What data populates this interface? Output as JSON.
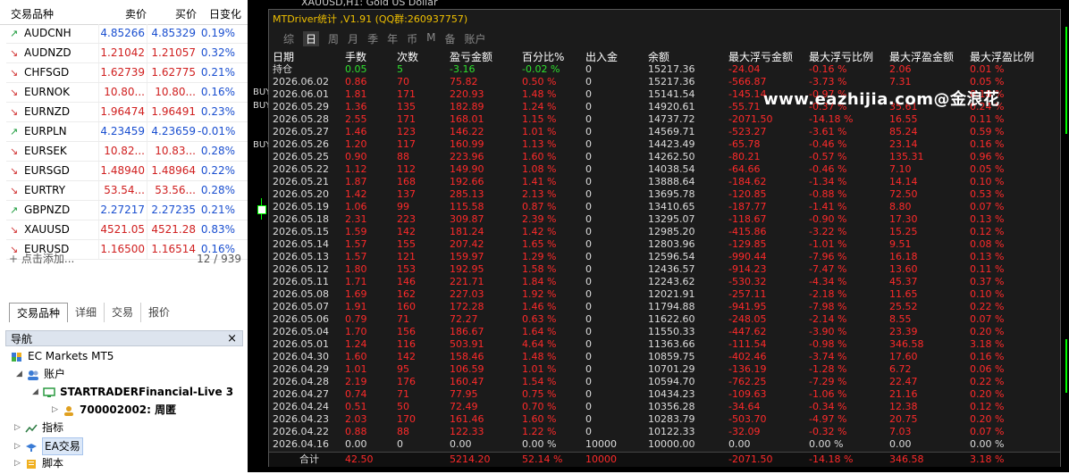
{
  "market_watch": {
    "headers": {
      "symbol": "交易品种",
      "bid": "卖价",
      "ask": "买价",
      "change": "日变化"
    },
    "rows": [
      {
        "symbol": "AUDCNH",
        "dir": "up",
        "bid": "4.85266",
        "ask": "4.85329",
        "change": "0.19%"
      },
      {
        "symbol": "AUDNZD",
        "dir": "dn",
        "bid": "1.21042",
        "ask": "1.21057",
        "change": "0.32%"
      },
      {
        "symbol": "CHFSGD",
        "dir": "dn",
        "bid": "1.62739",
        "ask": "1.62775",
        "change": "0.21%"
      },
      {
        "symbol": "EURNOK",
        "dir": "dn",
        "bid": "10.80...",
        "ask": "10.80...",
        "change": "0.16%"
      },
      {
        "symbol": "EURNZD",
        "dir": "dn",
        "bid": "1.96474",
        "ask": "1.96491",
        "change": "0.23%"
      },
      {
        "symbol": "EURPLN",
        "dir": "up",
        "bid": "4.23459",
        "ask": "4.23659",
        "change": "-0.01%"
      },
      {
        "symbol": "EURSEK",
        "dir": "dn",
        "bid": "10.82...",
        "ask": "10.83...",
        "change": "0.28%"
      },
      {
        "symbol": "EURSGD",
        "dir": "dn",
        "bid": "1.48940",
        "ask": "1.48964",
        "change": "0.22%"
      },
      {
        "symbol": "EURTRY",
        "dir": "dn",
        "bid": "53.54...",
        "ask": "53.56...",
        "change": "0.28%"
      },
      {
        "symbol": "GBPNZD",
        "dir": "up",
        "bid": "2.27217",
        "ask": "2.27235",
        "change": "0.21%"
      },
      {
        "symbol": "XAUUSD",
        "dir": "dn",
        "bid": "4521.05",
        "ask": "4521.28",
        "change": "0.83%"
      },
      {
        "symbol": "EURUSD",
        "dir": "dn",
        "bid": "1.16500",
        "ask": "1.16514",
        "change": "0.16%"
      }
    ],
    "add_label": "点击添加...",
    "count": "12 / 939",
    "tabs": [
      "交易品种",
      "详细",
      "交易",
      "报价"
    ]
  },
  "navigator": {
    "title": "导航",
    "close": "×",
    "items": {
      "broker": "EC Markets MT5",
      "accounts": "账户",
      "server": "STARTRADERFinancial-Live 3",
      "account": "700002002: 周匿",
      "indicators": "指标",
      "experts": "EA交易",
      "scripts": "脚本"
    }
  },
  "chart": {
    "title": "XAUUSD,H1: Gold US Dollar",
    "labels": [
      "BUY",
      "BUY",
      "BUY"
    ]
  },
  "stats_panel": {
    "title": "MTDriver统计 ,V1.91 (QQ群:260937757)",
    "tabs": [
      "综",
      "日",
      "周",
      "月",
      "季",
      "年",
      "币",
      "M",
      "备",
      "账户"
    ],
    "active_tab": "日",
    "watermark": "www.eazhijia.com@金浪花",
    "headers": [
      "日期",
      "手数",
      "次数",
      "盈亏金额",
      "百分比%",
      "出入金",
      "余额",
      "最大浮亏金额",
      "最大浮亏比例",
      "最大浮盈金额",
      "最大浮盈比例"
    ],
    "holding": [
      "持仓",
      "0.05",
      "5",
      "-3.16",
      "-0.02 %",
      "0",
      "15217.36",
      "-24.04",
      "-0.16 %",
      "2.06",
      "0.01 %"
    ],
    "rows": [
      [
        "2026.06.02",
        "0.86",
        "70",
        "75.82",
        "0.50 %",
        "0",
        "15217.36",
        "-566.87",
        "-3.73 %",
        "7.31",
        "0.05 %"
      ],
      [
        "2026.06.01",
        "1.81",
        "171",
        "220.93",
        "1.48 %",
        "0",
        "15141.54",
        "-145.14",
        "-0.97 %",
        "",
        "0.18 %"
      ],
      [
        "2026.05.29",
        "1.36",
        "135",
        "182.89",
        "1.24 %",
        "0",
        "14920.61",
        "-55.71",
        "-0.37 %",
        "35.61",
        "0.24 %"
      ],
      [
        "2026.05.28",
        "2.55",
        "171",
        "168.01",
        "1.15 %",
        "0",
        "14737.72",
        "-2071.50",
        "-14.18 %",
        "16.55",
        "0.11 %"
      ],
      [
        "2026.05.27",
        "1.46",
        "123",
        "146.22",
        "1.01 %",
        "0",
        "14569.71",
        "-523.27",
        "-3.61 %",
        "85.24",
        "0.59 %"
      ],
      [
        "2026.05.26",
        "1.20",
        "117",
        "160.99",
        "1.13 %",
        "0",
        "14423.49",
        "-65.78",
        "-0.46 %",
        "23.14",
        "0.16 %"
      ],
      [
        "2026.05.25",
        "0.90",
        "88",
        "223.96",
        "1.60 %",
        "0",
        "14262.50",
        "-80.21",
        "-0.57 %",
        "135.31",
        "0.96 %"
      ],
      [
        "2026.05.22",
        "1.12",
        "112",
        "149.90",
        "1.08 %",
        "0",
        "14038.54",
        "-64.66",
        "-0.46 %",
        "7.10",
        "0.05 %"
      ],
      [
        "2026.05.21",
        "1.87",
        "168",
        "192.66",
        "1.41 %",
        "0",
        "13888.64",
        "-184.62",
        "-1.34 %",
        "14.14",
        "0.10 %"
      ],
      [
        "2026.05.20",
        "1.42",
        "137",
        "285.13",
        "2.13 %",
        "0",
        "13695.78",
        "-120.85",
        "-0.88 %",
        "72.50",
        "0.53 %"
      ],
      [
        "2026.05.19",
        "1.06",
        "99",
        "115.58",
        "0.87 %",
        "0",
        "13410.65",
        "-187.77",
        "-1.41 %",
        "8.80",
        "0.07 %"
      ],
      [
        "2026.05.18",
        "2.31",
        "223",
        "309.87",
        "2.39 %",
        "0",
        "13295.07",
        "-118.67",
        "-0.90 %",
        "17.30",
        "0.13 %"
      ],
      [
        "2026.05.15",
        "1.59",
        "142",
        "181.24",
        "1.42 %",
        "0",
        "12985.20",
        "-415.86",
        "-3.22 %",
        "15.25",
        "0.12 %"
      ],
      [
        "2026.05.14",
        "1.57",
        "155",
        "207.42",
        "1.65 %",
        "0",
        "12803.96",
        "-129.85",
        "-1.01 %",
        "9.51",
        "0.08 %"
      ],
      [
        "2026.05.13",
        "1.57",
        "121",
        "159.97",
        "1.29 %",
        "0",
        "12596.54",
        "-990.44",
        "-7.96 %",
        "16.18",
        "0.13 %"
      ],
      [
        "2026.05.12",
        "1.80",
        "153",
        "192.95",
        "1.58 %",
        "0",
        "12436.57",
        "-914.23",
        "-7.47 %",
        "13.60",
        "0.11 %"
      ],
      [
        "2026.05.11",
        "1.71",
        "146",
        "221.71",
        "1.84 %",
        "0",
        "12243.62",
        "-530.32",
        "-4.34 %",
        "45.37",
        "0.37 %"
      ],
      [
        "2026.05.08",
        "1.69",
        "162",
        "227.03",
        "1.92 %",
        "0",
        "12021.91",
        "-257.11",
        "-2.18 %",
        "11.65",
        "0.10 %"
      ],
      [
        "2026.05.07",
        "1.91",
        "160",
        "172.28",
        "1.46 %",
        "0",
        "11794.88",
        "-941.95",
        "-7.98 %",
        "25.52",
        "0.22 %"
      ],
      [
        "2026.05.06",
        "0.79",
        "71",
        "72.27",
        "0.63 %",
        "0",
        "11622.60",
        "-248.05",
        "-2.14 %",
        "8.55",
        "0.07 %"
      ],
      [
        "2026.05.04",
        "1.70",
        "156",
        "186.67",
        "1.64 %",
        "0",
        "11550.33",
        "-447.62",
        "-3.90 %",
        "23.39",
        "0.20 %"
      ],
      [
        "2026.05.01",
        "1.24",
        "116",
        "503.91",
        "4.64 %",
        "0",
        "11363.66",
        "-111.54",
        "-0.98 %",
        "346.58",
        "3.18 %"
      ],
      [
        "2026.04.30",
        "1.60",
        "142",
        "158.46",
        "1.48 %",
        "0",
        "10859.75",
        "-402.46",
        "-3.74 %",
        "17.60",
        "0.16 %"
      ],
      [
        "2026.04.29",
        "1.01",
        "95",
        "106.59",
        "1.01 %",
        "0",
        "10701.29",
        "-136.19",
        "-1.28 %",
        "6.72",
        "0.06 %"
      ],
      [
        "2026.04.28",
        "2.19",
        "176",
        "160.47",
        "1.54 %",
        "0",
        "10594.70",
        "-762.25",
        "-7.29 %",
        "22.47",
        "0.22 %"
      ],
      [
        "2026.04.27",
        "0.74",
        "71",
        "77.95",
        "0.75 %",
        "0",
        "10434.23",
        "-109.63",
        "-1.06 %",
        "21.16",
        "0.20 %"
      ],
      [
        "2026.04.24",
        "0.51",
        "50",
        "72.49",
        "0.70 %",
        "0",
        "10356.28",
        "-34.64",
        "-0.34 %",
        "12.38",
        "0.12 %"
      ],
      [
        "2026.04.23",
        "2.03",
        "170",
        "161.46",
        "1.60 %",
        "0",
        "10283.79",
        "-503.70",
        "-4.97 %",
        "20.75",
        "0.20 %"
      ],
      [
        "2026.04.22",
        "0.88",
        "88",
        "122.33",
        "1.22 %",
        "0",
        "10122.33",
        "-32.09",
        "-0.32 %",
        "7.03",
        "0.07 %"
      ],
      [
        "2026.04.16",
        "0.00",
        "0",
        "0.00",
        "0.00 %",
        "10000",
        "10000.00",
        "0.00",
        "0.00 %",
        "0.00",
        "0.00 %"
      ]
    ],
    "total": [
      "合计",
      "42.50",
      "",
      "5214.20",
      "52.14 %",
      "10000",
      "",
      "-2071.50",
      "-14.18 %",
      "346.58",
      "3.18 %"
    ]
  },
  "colors": {
    "up": "#1a9a3a",
    "down": "#d03030",
    "panel_bg": "#1b1b1b",
    "green": "#2ee02e",
    "red": "#ff2a2a"
  }
}
